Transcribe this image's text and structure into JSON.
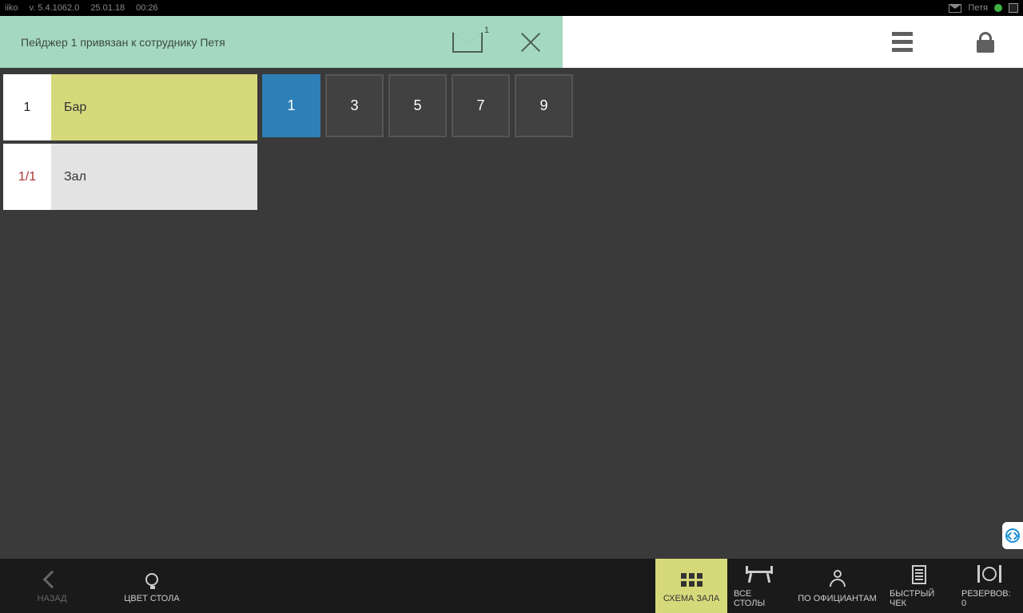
{
  "status": {
    "app": "iiko",
    "version": "v. 5.4.1062.0",
    "date": "25.01.18",
    "time": "00:26",
    "user": "Петя"
  },
  "notification": {
    "text": "Пейджер 1 привязан к сотруднику Петя",
    "badge": "1"
  },
  "rooms": [
    {
      "count": "1",
      "name": "Бар",
      "active": true
    },
    {
      "count": "1/1",
      "name": "Зал",
      "active": false
    }
  ],
  "tables": [
    {
      "label": "1",
      "selected": true
    },
    {
      "label": "3",
      "selected": false
    },
    {
      "label": "5",
      "selected": false
    },
    {
      "label": "7",
      "selected": false
    },
    {
      "label": "9",
      "selected": false
    }
  ],
  "bottombar": {
    "back": "НАЗАД",
    "color": "ЦВЕТ СТОЛА",
    "scheme": "СХЕМА ЗАЛА",
    "all_tables": "ВСЕ СТОЛЫ",
    "by_waiter": "ПО ОФИЦИАНТАМ",
    "quick": "БЫСТРЫЙ ЧЕК",
    "reserves": "РЕЗЕРВОВ: 0"
  }
}
